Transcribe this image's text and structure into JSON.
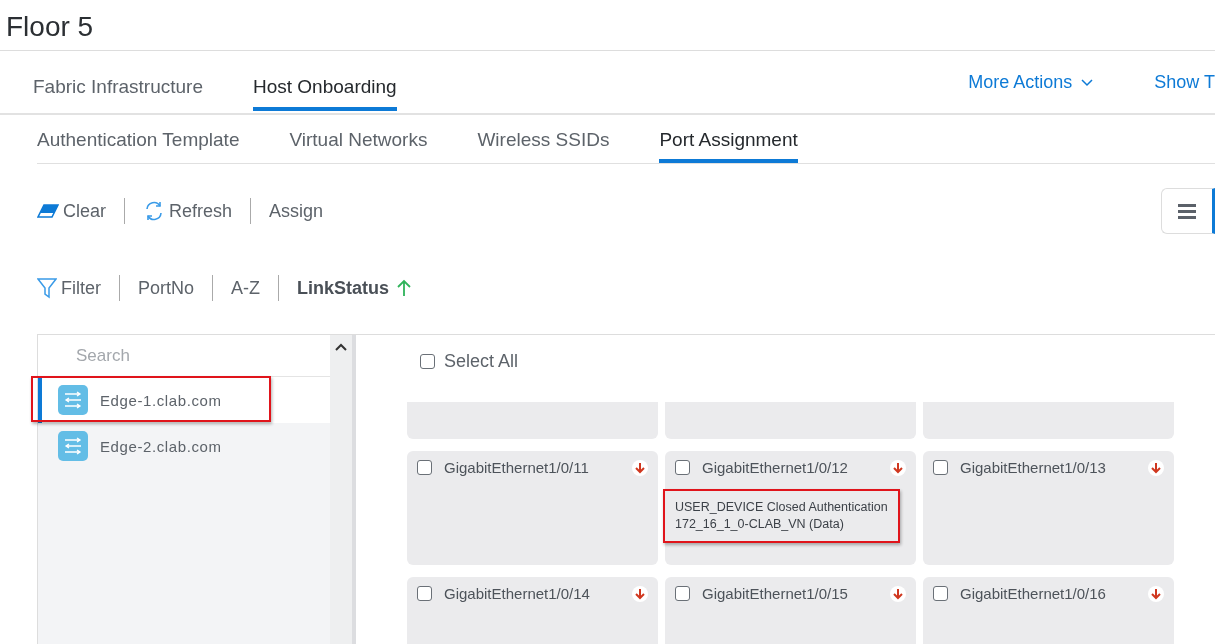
{
  "page": {
    "title": "Floor 5"
  },
  "main_tabs": [
    {
      "label": "Fabric Infrastructure",
      "selected": false
    },
    {
      "label": "Host Onboarding",
      "selected": true
    }
  ],
  "header_actions": {
    "more_actions": "More Actions",
    "show": "Show T"
  },
  "sub_tabs": [
    {
      "label": "Authentication Template",
      "selected": false
    },
    {
      "label": "Virtual Networks",
      "selected": false
    },
    {
      "label": "Wireless SSIDs",
      "selected": false
    },
    {
      "label": "Port Assignment",
      "selected": true
    }
  ],
  "toolbar": [
    {
      "kind": "clear",
      "label": "Clear"
    },
    {
      "kind": "refresh",
      "label": "Refresh"
    },
    {
      "kind": "plain",
      "label": "Assign"
    }
  ],
  "sort_bar": {
    "filter": "Filter",
    "options": [
      {
        "label": "PortNo",
        "selected": false
      },
      {
        "label": "A-Z",
        "selected": false
      },
      {
        "label": "LinkStatus",
        "selected": true
      }
    ]
  },
  "devices": {
    "search_placeholder": "Search",
    "items": [
      {
        "name": "Edge-1.clab.com",
        "selected": true,
        "highlighted": true
      },
      {
        "name": "Edge-2.clab.com",
        "selected": false,
        "highlighted": false
      }
    ]
  },
  "select_all": {
    "label": "Select All",
    "checked": false
  },
  "ports": [
    {
      "name": "GigabitEthernet1/0/11",
      "checked": false,
      "link_up": false
    },
    {
      "name": "GigabitEthernet1/0/12",
      "checked": false,
      "link_up": false,
      "assignment": [
        "USER_DEVICE Closed Authentication",
        "172_16_1_0-CLAB_VN (Data)"
      ],
      "highlighted": true
    },
    {
      "name": "GigabitEthernet1/0/13",
      "checked": false,
      "link_up": false
    },
    {
      "name": "GigabitEthernet1/0/14",
      "checked": false,
      "link_up": false
    },
    {
      "name": "GigabitEthernet1/0/15",
      "checked": false,
      "link_up": false
    },
    {
      "name": "GigabitEthernet1/0/16",
      "checked": false,
      "link_up": false
    }
  ]
}
